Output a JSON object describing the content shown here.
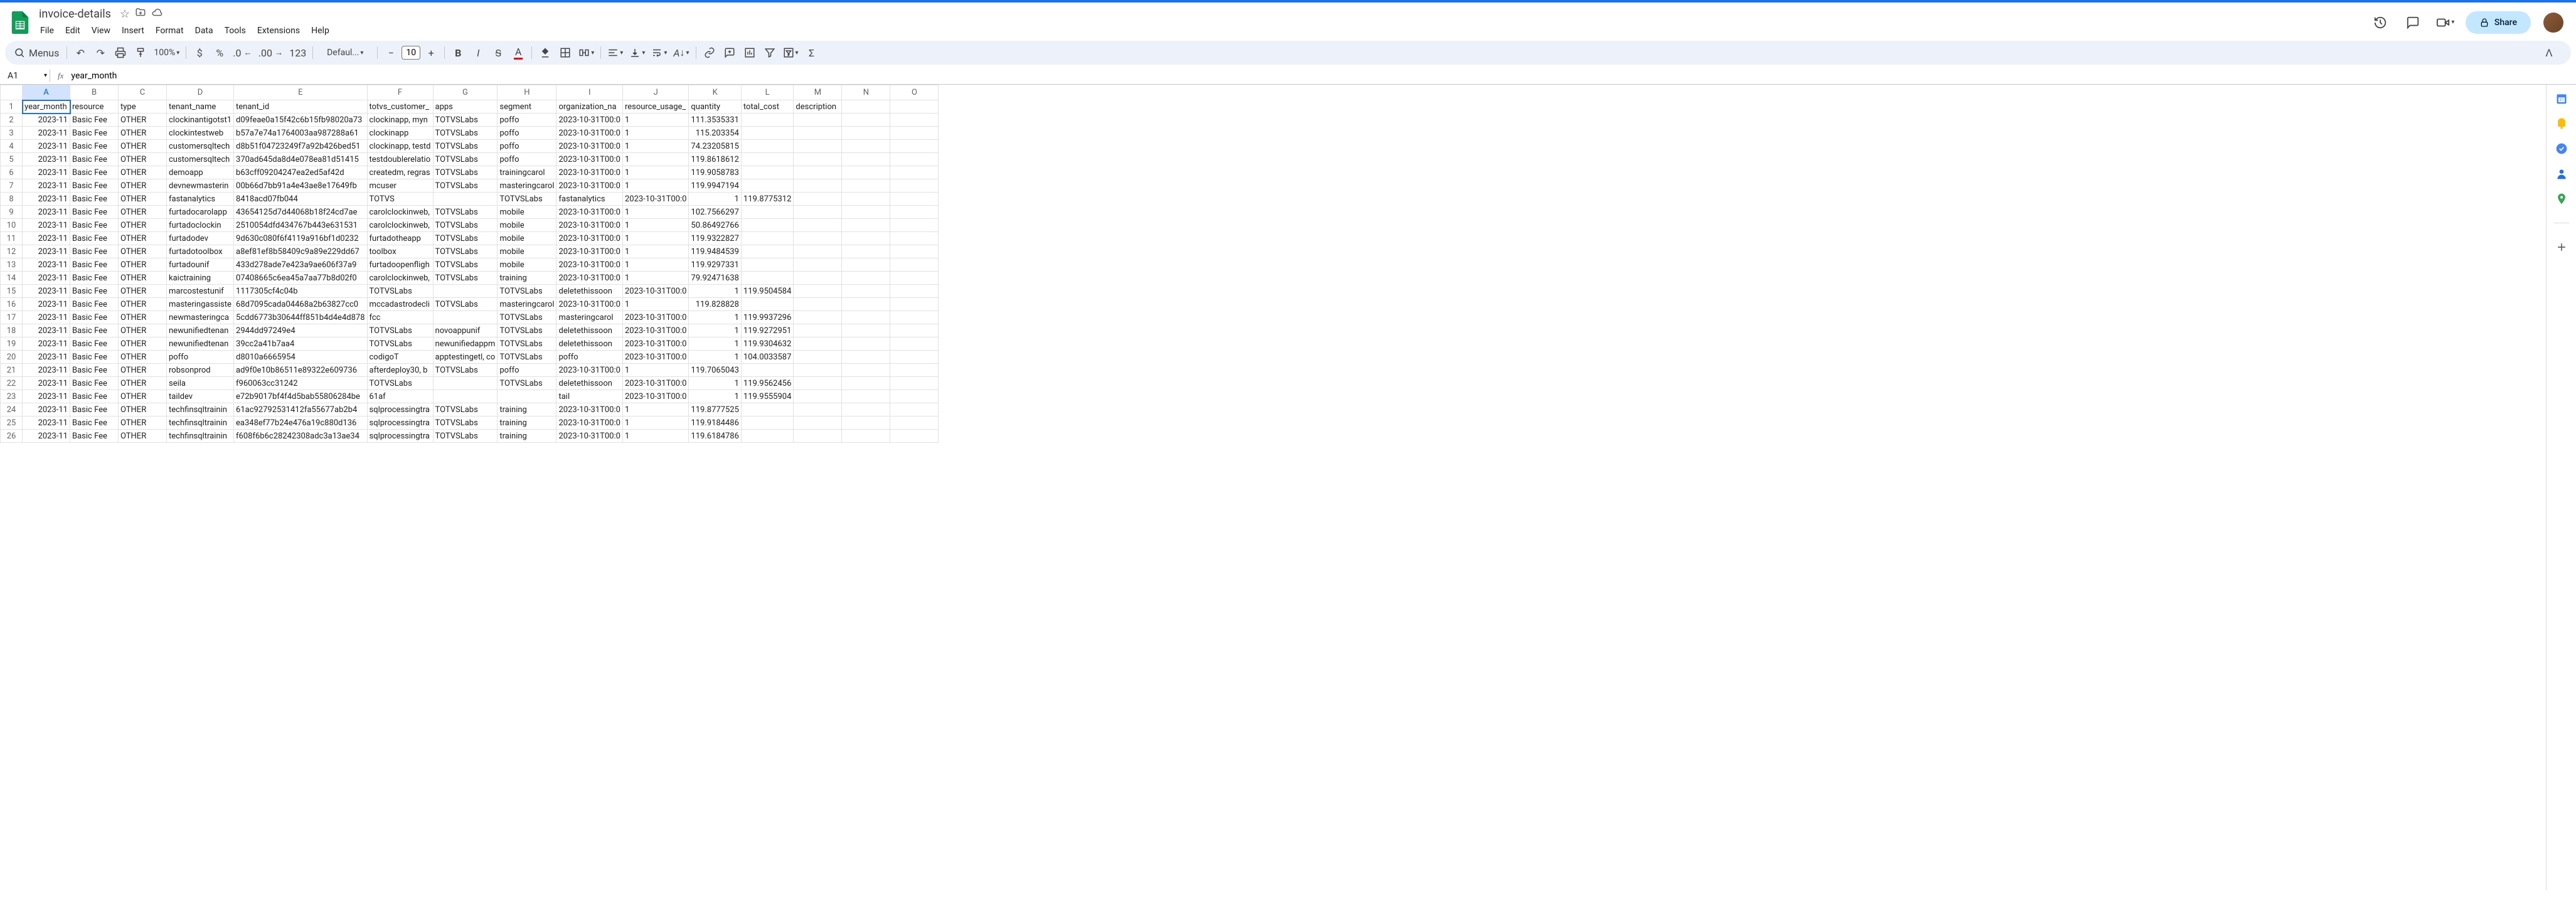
{
  "doc": {
    "title": "invoice-details"
  },
  "menus": [
    "File",
    "Edit",
    "View",
    "Insert",
    "Format",
    "Data",
    "Tools",
    "Extensions",
    "Help"
  ],
  "toolbar": {
    "search_label": "Menus",
    "zoom": "100%",
    "font": "Defaul...",
    "font_size": "10",
    "share": "Share"
  },
  "formula": {
    "cell": "A1",
    "value": "year_month"
  },
  "columns": [
    "A",
    "B",
    "C",
    "D",
    "E",
    "F",
    "G",
    "H",
    "I",
    "J",
    "K",
    "L",
    "M",
    "N",
    "O"
  ],
  "headers": [
    "year_month",
    "resource",
    "type",
    "tenant_name",
    "tenant_id",
    "totvs_customer_",
    "apps",
    "segment",
    "organization_na",
    "resource_usage_",
    "quantity",
    "total_cost",
    "description",
    "",
    ""
  ],
  "rows": [
    {
      "n": 2,
      "c": [
        "2023-11",
        "Basic Fee",
        "OTHER",
        "clockinantigotst1",
        "d09feae0a15f42c6b15fb98020a73",
        "clockinapp, myn",
        "TOTVSLabs",
        "poffo",
        "2023-10-31T00:0",
        "1",
        "111.3535331",
        "",
        "",
        ""
      ]
    },
    {
      "n": 3,
      "c": [
        "2023-11",
        "Basic Fee",
        "OTHER",
        "clockintestweb",
        "b57a7e74a1764003aa987288a61",
        "clockinapp",
        "TOTVSLabs",
        "poffo",
        "2023-10-31T00:0",
        "1",
        "115.203354",
        "",
        "",
        ""
      ]
    },
    {
      "n": 4,
      "c": [
        "2023-11",
        "Basic Fee",
        "OTHER",
        "customersqltech",
        "d8b51f04723249f7a92b426bed51",
        "clockinapp, testd",
        "TOTVSLabs",
        "poffo",
        "2023-10-31T00:0",
        "1",
        "74.23205815",
        "",
        "",
        ""
      ]
    },
    {
      "n": 5,
      "c": [
        "2023-11",
        "Basic Fee",
        "OTHER",
        "customersqltech",
        "370ad645da8d4e078ea81d51415",
        "testdoublerelatio",
        "TOTVSLabs",
        "poffo",
        "2023-10-31T00:0",
        "1",
        "119.8618612",
        "",
        "",
        ""
      ]
    },
    {
      "n": 6,
      "c": [
        "2023-11",
        "Basic Fee",
        "OTHER",
        "demoapp",
        "b63cff09204247ea2ed5af42d",
        "createdm, regras",
        "TOTVSLabs",
        "trainingcarol",
        "2023-10-31T00:0",
        "1",
        "119.9058783",
        "",
        "",
        ""
      ]
    },
    {
      "n": 7,
      "c": [
        "2023-11",
        "Basic Fee",
        "OTHER",
        "devnewmasterin",
        "00b66d7bb91a4e43ae8e17649fb",
        "mcuser",
        "TOTVSLabs",
        "masteringcarol",
        "2023-10-31T00:0",
        "1",
        "119.9947194",
        "",
        "",
        ""
      ]
    },
    {
      "n": 8,
      "c": [
        "2023-11",
        "Basic Fee",
        "OTHER",
        "fastanalytics",
        "8418acd07fb044",
        "TOTVS",
        "",
        "TOTVSLabs",
        "fastanalytics",
        "2023-10-31T00:0",
        "1",
        "119.8775312",
        "",
        "",
        ""
      ]
    },
    {
      "n": 9,
      "c": [
        "2023-11",
        "Basic Fee",
        "OTHER",
        "furtadocarolapp",
        "43654125d7d44068b18f24cd7ae",
        "carolclockinweb,",
        "TOTVSLabs",
        "mobile",
        "2023-10-31T00:0",
        "1",
        "102.7566297",
        "",
        "",
        ""
      ]
    },
    {
      "n": 10,
      "c": [
        "2023-11",
        "Basic Fee",
        "OTHER",
        "furtadoclockin",
        "2510054dfd434767b443e631531",
        "carolclockinweb,",
        "TOTVSLabs",
        "mobile",
        "2023-10-31T00:0",
        "1",
        "50.86492766",
        "",
        "",
        ""
      ]
    },
    {
      "n": 11,
      "c": [
        "2023-11",
        "Basic Fee",
        "OTHER",
        "furtadodev",
        "9d630c080f6f4119a916bf1d0232",
        "furtadotheapp",
        "TOTVSLabs",
        "mobile",
        "2023-10-31T00:0",
        "1",
        "119.9322827",
        "",
        "",
        ""
      ]
    },
    {
      "n": 12,
      "c": [
        "2023-11",
        "Basic Fee",
        "OTHER",
        "furtadotoolbox",
        "a8ef81ef8b58409c9a89e229dd67",
        "toolbox",
        "TOTVSLabs",
        "mobile",
        "2023-10-31T00:0",
        "1",
        "119.9484539",
        "",
        "",
        ""
      ]
    },
    {
      "n": 13,
      "c": [
        "2023-11",
        "Basic Fee",
        "OTHER",
        "furtadounif",
        "433d278ade7e423a9ae606f37a9",
        "furtadoopenfligh",
        "TOTVSLabs",
        "mobile",
        "2023-10-31T00:0",
        "1",
        "119.9297331",
        "",
        "",
        ""
      ]
    },
    {
      "n": 14,
      "c": [
        "2023-11",
        "Basic Fee",
        "OTHER",
        "kaictraining",
        "07408665c6ea45a7aa77b8d02f0",
        "carolclockinweb,",
        "TOTVSLabs",
        "training",
        "2023-10-31T00:0",
        "1",
        "79.92471638",
        "",
        "",
        ""
      ]
    },
    {
      "n": 15,
      "c": [
        "2023-11",
        "Basic Fee",
        "OTHER",
        "marcostestunif",
        "1117305cf4c04b",
        "TOTVSLabs",
        "",
        "TOTVSLabs",
        "deletethissoon",
        "2023-10-31T00:0",
        "1",
        "119.9504584",
        "",
        "",
        ""
      ]
    },
    {
      "n": 16,
      "c": [
        "2023-11",
        "Basic Fee",
        "OTHER",
        "masteringassiste",
        "68d7095cada04468a2b63827cc0",
        "mccadastrodecli",
        "TOTVSLabs",
        "masteringcarol",
        "2023-10-31T00:0",
        "1",
        "119.828828",
        "",
        "",
        ""
      ]
    },
    {
      "n": 17,
      "c": [
        "2023-11",
        "Basic Fee",
        "OTHER",
        "newmasteringca",
        "5cdd6773b30644ff851b4d4e4d878",
        "fcc",
        "",
        "TOTVSLabs",
        "masteringcarol",
        "2023-10-31T00:0",
        "1",
        "119.9937296",
        "",
        "",
        ""
      ]
    },
    {
      "n": 18,
      "c": [
        "2023-11",
        "Basic Fee",
        "OTHER",
        "newunifiedtenan",
        "2944dd97249e4",
        "TOTVSLabs",
        "novoappunif",
        "TOTVSLabs",
        "deletethissoon",
        "2023-10-31T00:0",
        "1",
        "119.9272951",
        "",
        "",
        ""
      ]
    },
    {
      "n": 19,
      "c": [
        "2023-11",
        "Basic Fee",
        "OTHER",
        "newunifiedtenan",
        "39cc2a41b7aa4",
        "TOTVSLabs",
        "newunifiedappm",
        "TOTVSLabs",
        "deletethissoon",
        "2023-10-31T00:0",
        "1",
        "119.9304632",
        "",
        "",
        ""
      ]
    },
    {
      "n": 20,
      "c": [
        "2023-11",
        "Basic Fee",
        "OTHER",
        "poffo",
        "d8010a6665954",
        "codigoT",
        "apptestingetl, co",
        "TOTVSLabs",
        "poffo",
        "2023-10-31T00:0",
        "1",
        "104.0033587",
        "",
        "",
        ""
      ]
    },
    {
      "n": 21,
      "c": [
        "2023-11",
        "Basic Fee",
        "OTHER",
        "robsonprod",
        "ad9f0e10b86511e89322e609736",
        "afterdeploy30, b",
        "TOTVSLabs",
        "poffo",
        "2023-10-31T00:0",
        "1",
        "119.7065043",
        "",
        "",
        ""
      ]
    },
    {
      "n": 22,
      "c": [
        "2023-11",
        "Basic Fee",
        "OTHER",
        "seila",
        "f960063cc31242",
        "TOTVSLabs",
        "",
        "TOTVSLabs",
        "deletethissoon",
        "2023-10-31T00:0",
        "1",
        "119.9562456",
        "",
        "",
        ""
      ]
    },
    {
      "n": 23,
      "c": [
        "2023-11",
        "Basic Fee",
        "OTHER",
        "taildev",
        "e72b9017bf4f4d5bab55806284be",
        "61af",
        "",
        "",
        "tail",
        "2023-10-31T00:0",
        "1",
        "119.9555904",
        "",
        "",
        ""
      ]
    },
    {
      "n": 24,
      "c": [
        "2023-11",
        "Basic Fee",
        "OTHER",
        "techfinsqltrainin",
        "61ac92792531412fa55677ab2b4",
        "sqlprocessingtra",
        "TOTVSLabs",
        "training",
        "2023-10-31T00:0",
        "1",
        "119.8777525",
        "",
        "",
        ""
      ]
    },
    {
      "n": 25,
      "c": [
        "2023-11",
        "Basic Fee",
        "OTHER",
        "techfinsqltrainin",
        "ea348ef77b24e476a19c880d136",
        "sqlprocessingtra",
        "TOTVSLabs",
        "training",
        "2023-10-31T00:0",
        "1",
        "119.9184486",
        "",
        "",
        ""
      ]
    },
    {
      "n": 26,
      "c": [
        "2023-11",
        "Basic Fee",
        "OTHER",
        "techfinsqltrainin",
        "f608f6b6c28242308adc3a13ae34",
        "sqlprocessingtra",
        "TOTVSLabs",
        "training",
        "2023-10-31T00:0",
        "1",
        "119.6184786",
        "",
        "",
        ""
      ]
    }
  ]
}
